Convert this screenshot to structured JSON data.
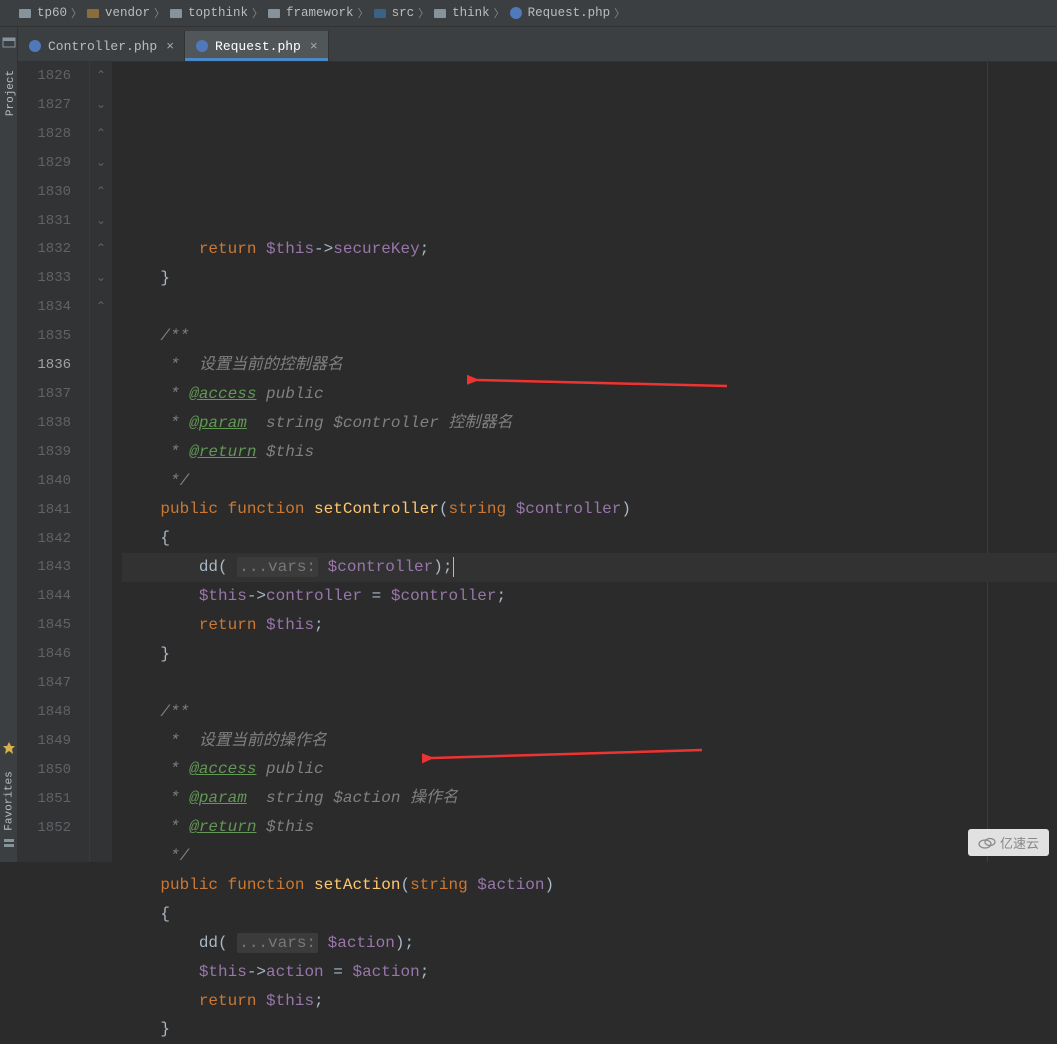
{
  "breadcrumbs": [
    {
      "label": "tp60",
      "icon": "folder"
    },
    {
      "label": "vendor",
      "icon": "folder-pkg"
    },
    {
      "label": "topthink",
      "icon": "folder"
    },
    {
      "label": "framework",
      "icon": "folder"
    },
    {
      "label": "src",
      "icon": "folder-src"
    },
    {
      "label": "think",
      "icon": "folder"
    },
    {
      "label": "Request.php",
      "icon": "php"
    }
  ],
  "tabs": [
    {
      "label": "Controller.php",
      "active": false
    },
    {
      "label": "Request.php",
      "active": true
    }
  ],
  "sideTools": {
    "project": "Project",
    "favorites": "Favorites"
  },
  "gutter": {
    "start": 1826,
    "end": 1852,
    "highlight": 1836
  },
  "code": {
    "l1825_html": "<span class='k'>return</span> <span class='v'>$this</span><span class='p'>-&gt;</span><span class='v'>secureKey</span><span class='p'>;</span>",
    "l1826": "}",
    "l1828": "/**",
    "l1829": " *  设置当前的控制器名",
    "l1830_t": "@access",
    "l1830_r": " public",
    "l1831_t": "@param",
    "l1831_r": "  string $controller 控制器名",
    "l1832_t": "@return",
    "l1832_r": " $this",
    "l1833": " */",
    "l1834_k1": "public",
    "l1834_k2": "function",
    "l1834_fn": "setController",
    "l1834_ty": "string",
    "l1834_v": "$controller",
    "l1835": "{",
    "l1836_fn": "dd",
    "l1836_hint": "...vars:",
    "l1836_v": "$controller",
    "l1837_v1": "$this",
    "l1837_p1": "controller",
    "l1837_v2": "$controller",
    "l1838_k": "return",
    "l1838_v": "$this",
    "l1839": "}",
    "l1841": "/**",
    "l1842": " *  设置当前的操作名",
    "l1843_t": "@access",
    "l1843_r": " public",
    "l1844_t": "@param",
    "l1844_r": "  string $action 操作名",
    "l1845_t": "@return",
    "l1845_r": " $this",
    "l1846": " */",
    "l1847_k1": "public",
    "l1847_k2": "function",
    "l1847_fn": "setAction",
    "l1847_ty": "string",
    "l1847_v": "$action",
    "l1848": "{",
    "l1849_fn": "dd",
    "l1849_hint": "...vars:",
    "l1849_v": "$action",
    "l1850_v1": "$this",
    "l1850_p1": "action",
    "l1850_v2": "$action",
    "l1851_k": "return",
    "l1851_v": "$this",
    "l1852": "}"
  },
  "watermark": "亿速云"
}
